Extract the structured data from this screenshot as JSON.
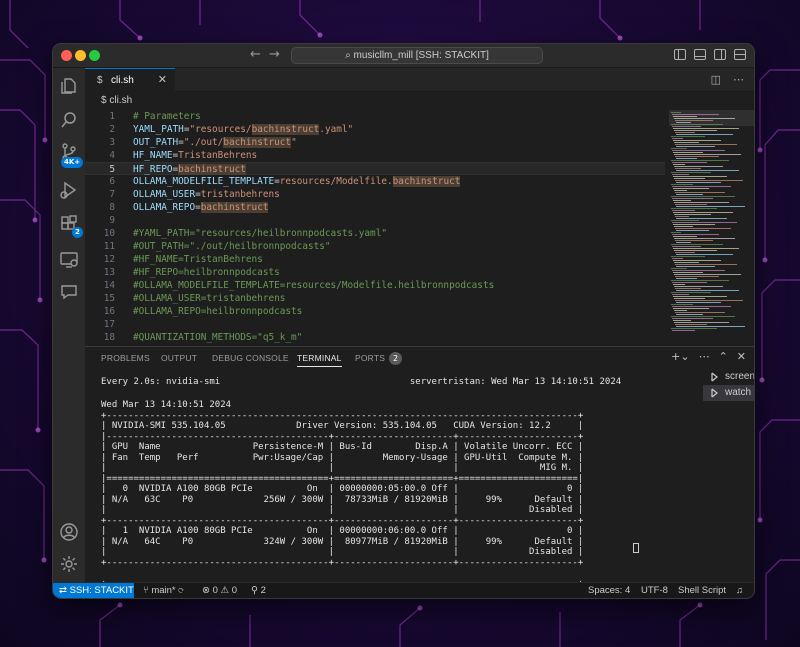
{
  "window": {
    "command_center": "musicllm_mill [SSH: STACKIT]"
  },
  "activity": {
    "source_control_badge": "4K+",
    "extensions_badge": "2"
  },
  "tabs": [
    {
      "label": "cli.sh"
    }
  ],
  "breadcrumb": "cli.sh",
  "editor": {
    "lines": [
      {
        "n": "1",
        "segments": [
          {
            "t": "# Parameters",
            "c": "comment"
          }
        ]
      },
      {
        "n": "2",
        "segments": [
          {
            "t": "YAML_PATH",
            "c": "var"
          },
          {
            "t": "=",
            "c": "op"
          },
          {
            "t": "\"resources/",
            "c": "str"
          },
          {
            "t": "bachinstruct",
            "c": "str",
            "hl": true
          },
          {
            "t": ".yaml\"",
            "c": "str"
          }
        ]
      },
      {
        "n": "3",
        "segments": [
          {
            "t": "OUT_PATH",
            "c": "var"
          },
          {
            "t": "=",
            "c": "op"
          },
          {
            "t": "\"./out/",
            "c": "str"
          },
          {
            "t": "bachinstruct",
            "c": "str",
            "hl": true
          },
          {
            "t": "\"",
            "c": "str"
          }
        ]
      },
      {
        "n": "4",
        "segments": [
          {
            "t": "HF_NAME",
            "c": "var"
          },
          {
            "t": "=",
            "c": "op"
          },
          {
            "t": "TristanBehrens",
            "c": "str"
          }
        ]
      },
      {
        "n": "5",
        "segments": [
          {
            "t": "HF_REPO",
            "c": "var"
          },
          {
            "t": "=",
            "c": "op"
          },
          {
            "t": "bachinstruct",
            "c": "str",
            "hl": true
          }
        ],
        "current": true
      },
      {
        "n": "6",
        "segments": [
          {
            "t": "OLLAMA_MODELFILE_TEMPLATE",
            "c": "var"
          },
          {
            "t": "=",
            "c": "op"
          },
          {
            "t": "resources/Modelfile.",
            "c": "str"
          },
          {
            "t": "bachinstruct",
            "c": "str",
            "hl": true
          }
        ]
      },
      {
        "n": "7",
        "segments": [
          {
            "t": "OLLAMA_USER",
            "c": "var"
          },
          {
            "t": "=",
            "c": "op"
          },
          {
            "t": "tristanbehrens",
            "c": "str"
          }
        ]
      },
      {
        "n": "8",
        "segments": [
          {
            "t": "OLLAMA_REPO",
            "c": "var"
          },
          {
            "t": "=",
            "c": "op"
          },
          {
            "t": "bachinstruct",
            "c": "str",
            "hl": true
          }
        ]
      },
      {
        "n": "9",
        "segments": []
      },
      {
        "n": "10",
        "segments": [
          {
            "t": "#YAML_PATH=\"resources/heilbronnpodcasts.yaml\"",
            "c": "comment"
          }
        ]
      },
      {
        "n": "11",
        "segments": [
          {
            "t": "#OUT_PATH=\"./out/heilbronnpodcasts\"",
            "c": "comment"
          }
        ]
      },
      {
        "n": "12",
        "segments": [
          {
            "t": "#HF_NAME=TristanBehrens",
            "c": "comment"
          }
        ]
      },
      {
        "n": "13",
        "segments": [
          {
            "t": "#HF_REPO=heilbronnpodcasts",
            "c": "comment"
          }
        ]
      },
      {
        "n": "14",
        "segments": [
          {
            "t": "#OLLAMA_MODELFILE_TEMPLATE=resources/Modelfile.heilbronnpodcasts",
            "c": "comment"
          }
        ]
      },
      {
        "n": "15",
        "segments": [
          {
            "t": "#OLLAMA_USER=tristanbehrens",
            "c": "comment"
          }
        ]
      },
      {
        "n": "16",
        "segments": [
          {
            "t": "#OLLAMA_REPO=heilbronnpodcasts",
            "c": "comment"
          }
        ]
      },
      {
        "n": "17",
        "segments": []
      },
      {
        "n": "18",
        "segments": [
          {
            "t": "#QUANTIZATION_METHODS=\"q5_k_m\"",
            "c": "comment"
          }
        ]
      }
    ]
  },
  "panel": {
    "tabs": [
      "PROBLEMS",
      "OUTPUT",
      "DEBUG CONSOLE",
      "TERMINAL",
      "PORTS"
    ],
    "active_tab": "TERMINAL",
    "ports_count": "2",
    "terminal_lines": [
      "Every 2.0s: nvidia-smi                                   servertristan: Wed Mar 13 14:10:51 2024",
      "",
      "Wed Mar 13 14:10:51 2024",
      "+---------------------------------------------------------------------------------------+",
      "| NVIDIA-SMI 535.104.05             Driver Version: 535.104.05   CUDA Version: 12.2     |",
      "|-----------------------------------------+----------------------+----------------------+",
      "| GPU  Name                 Persistence-M | Bus-Id        Disp.A | Volatile Uncorr. ECC |",
      "| Fan  Temp   Perf          Pwr:Usage/Cap |         Memory-Usage | GPU-Util  Compute M. |",
      "|                                         |                      |               MIG M. |",
      "|=========================================+======================+======================|",
      "|   0  NVIDIA A100 80GB PCIe          On  | 00000000:05:00.0 Off |                    0 |",
      "| N/A   63C    P0             256W / 300W |  78733MiB / 81920MiB |     99%      Default |",
      "|                                         |                      |             Disabled |",
      "+-----------------------------------------+----------------------+----------------------+",
      "|   1  NVIDIA A100 80GB PCIe          On  | 00000000:06:00.0 Off |                    0 |",
      "| N/A   64C    P0             324W / 300W |  80977MiB / 81920MiB |     99%      Default |",
      "|                                         |                      |             Disabled |",
      "+-----------------------------------------+----------------------+----------------------+",
      "",
      "+---------------------------------------------------------------------------------------+"
    ],
    "terminal_sessions": [
      "screen",
      "watch"
    ]
  },
  "status": {
    "remote": "SSH: STACKIT",
    "branch": "main*",
    "errors": "0",
    "warnings": "0",
    "ports": "2",
    "spaces": "Spaces: 4",
    "encoding": "UTF-8",
    "language": "Shell Script"
  }
}
